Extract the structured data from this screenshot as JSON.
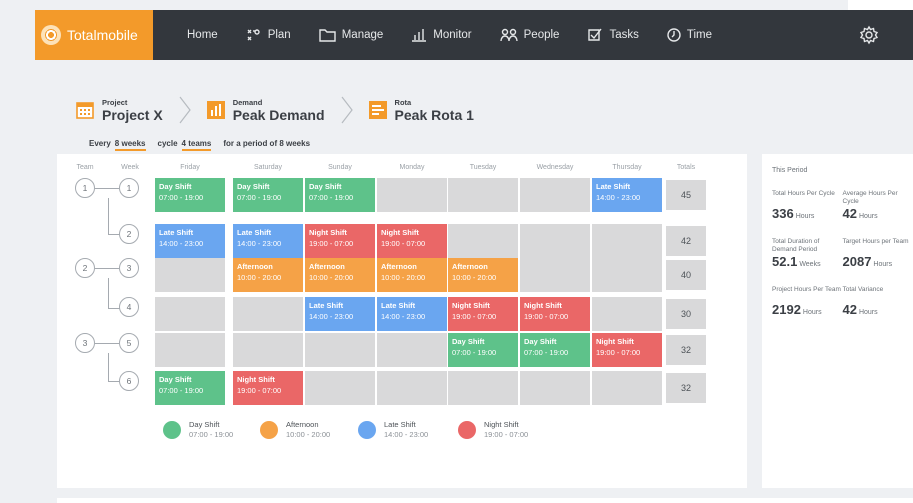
{
  "nav": {
    "brand": "Totalmobile",
    "items": [
      {
        "label": "Home",
        "icon": "none"
      },
      {
        "label": "Plan",
        "icon": "plan-icon"
      },
      {
        "label": "Manage",
        "icon": "folder-icon"
      },
      {
        "label": "Monitor",
        "icon": "bar-chart-icon"
      },
      {
        "label": "People",
        "icon": "people-icon"
      },
      {
        "label": "Tasks",
        "icon": "checkbox-icon"
      },
      {
        "label": "Time",
        "icon": "clock-icon"
      }
    ]
  },
  "breadcrumb": [
    {
      "small": "Project",
      "big": "Project X"
    },
    {
      "small": "Demand",
      "big": "Peak Demand"
    },
    {
      "small": "Rota",
      "big": "Peak Rota 1"
    }
  ],
  "period": {
    "every_label": "Every",
    "every_value": "8 weeks",
    "cycle_label": "cycle",
    "cycle_value": "4 teams",
    "period_text": "for a period of 8 weeks"
  },
  "grid": {
    "headers": {
      "team": "Team",
      "week": "Week",
      "days": [
        "Friday",
        "Saturday",
        "Sunday",
        "Monday",
        "Tuesday",
        "Wednesday",
        "Thursday"
      ],
      "totals": "Totals"
    },
    "teams": [
      "1",
      "2",
      "3"
    ],
    "weeks": [
      "1",
      "2",
      "3",
      "4",
      "5",
      "6"
    ],
    "totals": [
      "45",
      "42",
      "40",
      "30",
      "32",
      "32"
    ],
    "shifts": {
      "day": {
        "name": "Day Shift",
        "time": "07:00 - 19:00",
        "color": "#5ec28a"
      },
      "aft": {
        "name": "Afternoon",
        "time": "10:00 - 20:00",
        "color": "#f5a247"
      },
      "late": {
        "name": "Late Shift",
        "time": "14:00 - 23:00",
        "color": "#6aa6f0"
      },
      "night": {
        "name": "Night Shift",
        "time": "19:00 - 07:00",
        "color": "#ea6767"
      }
    },
    "rows": [
      [
        "day",
        "day",
        "day",
        "",
        "",
        "",
        "late"
      ],
      [
        "late",
        "late",
        "night",
        "night",
        "",
        "",
        ""
      ],
      [
        "",
        "aft",
        "aft",
        "aft",
        "aft",
        "",
        ""
      ],
      [
        "",
        "",
        "late",
        "late",
        "night",
        "night",
        ""
      ],
      [
        "",
        "",
        "",
        "",
        "day",
        "day",
        "night"
      ],
      [
        "day",
        "night",
        "",
        "",
        "",
        "",
        ""
      ]
    ]
  },
  "legend": [
    {
      "name": "Day Shift",
      "time": "07:00 - 19:00",
      "color": "#5ec28a"
    },
    {
      "name": "Afternoon",
      "time": "10:00 - 20:00",
      "color": "#f5a247"
    },
    {
      "name": "Late Shift",
      "time": "14:00 - 23:00",
      "color": "#6aa6f0"
    },
    {
      "name": "Night Shift",
      "time": "19:00 - 07:00",
      "color": "#ea6767"
    }
  ],
  "stats": {
    "title": "This Period",
    "items": [
      {
        "label": "Total Hours Per Cycle",
        "value": "336",
        "unit": "Hours"
      },
      {
        "label": "Average Hours Per Cycle",
        "value": "42",
        "unit": "Hours"
      },
      {
        "label": "Total Duration of Demand Period",
        "value": "52.1",
        "unit": "Weeks"
      },
      {
        "label": "Target Hours per Team",
        "value": "2087",
        "unit": "Hours"
      },
      {
        "label": "Project Hours Per Team",
        "value": "2192",
        "unit": "Hours"
      },
      {
        "label": "Total Variance",
        "value": "42",
        "unit": "Hours"
      }
    ]
  }
}
